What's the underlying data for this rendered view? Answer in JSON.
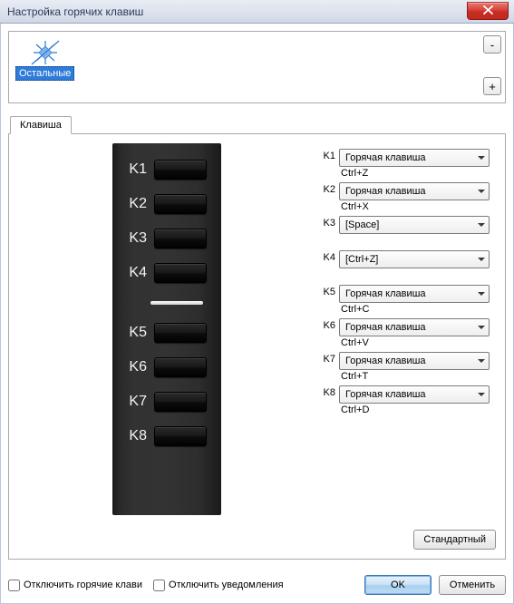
{
  "window": {
    "title": "Настройка горячих клавиш"
  },
  "top_panel": {
    "category_label": "Остальные",
    "minus": "-",
    "plus": "+"
  },
  "tab": {
    "label": "Клавиша"
  },
  "device_keys": [
    "K1",
    "K2",
    "K3",
    "K4",
    "K5",
    "K6",
    "K7",
    "K8"
  ],
  "rows": [
    {
      "key": "K1",
      "combo": "Горячая клавиша",
      "sub": "Ctrl+Z",
      "gap": false
    },
    {
      "key": "K2",
      "combo": "Горячая клавиша",
      "sub": "Ctrl+X",
      "gap": false
    },
    {
      "key": "K3",
      "combo": "[Space]",
      "sub": "",
      "gap": true
    },
    {
      "key": "K4",
      "combo": "[Ctrl+Z]",
      "sub": "",
      "gap": true
    },
    {
      "key": "K5",
      "combo": "Горячая клавиша",
      "sub": "Ctrl+C",
      "gap": false
    },
    {
      "key": "K6",
      "combo": "Горячая клавиша",
      "sub": "Ctrl+V",
      "gap": false
    },
    {
      "key": "K7",
      "combo": "Горячая клавиша",
      "sub": "Ctrl+T",
      "gap": false
    },
    {
      "key": "K8",
      "combo": "Горячая клавиша",
      "sub": "Ctrl+D",
      "gap": false
    }
  ],
  "buttons": {
    "standard": "Стандартный",
    "ok": "OK",
    "cancel": "Отменить"
  },
  "checkboxes": {
    "disable_hotkeys": "Отключить горячие клави",
    "disable_notifications": "Отключить уведомления"
  }
}
